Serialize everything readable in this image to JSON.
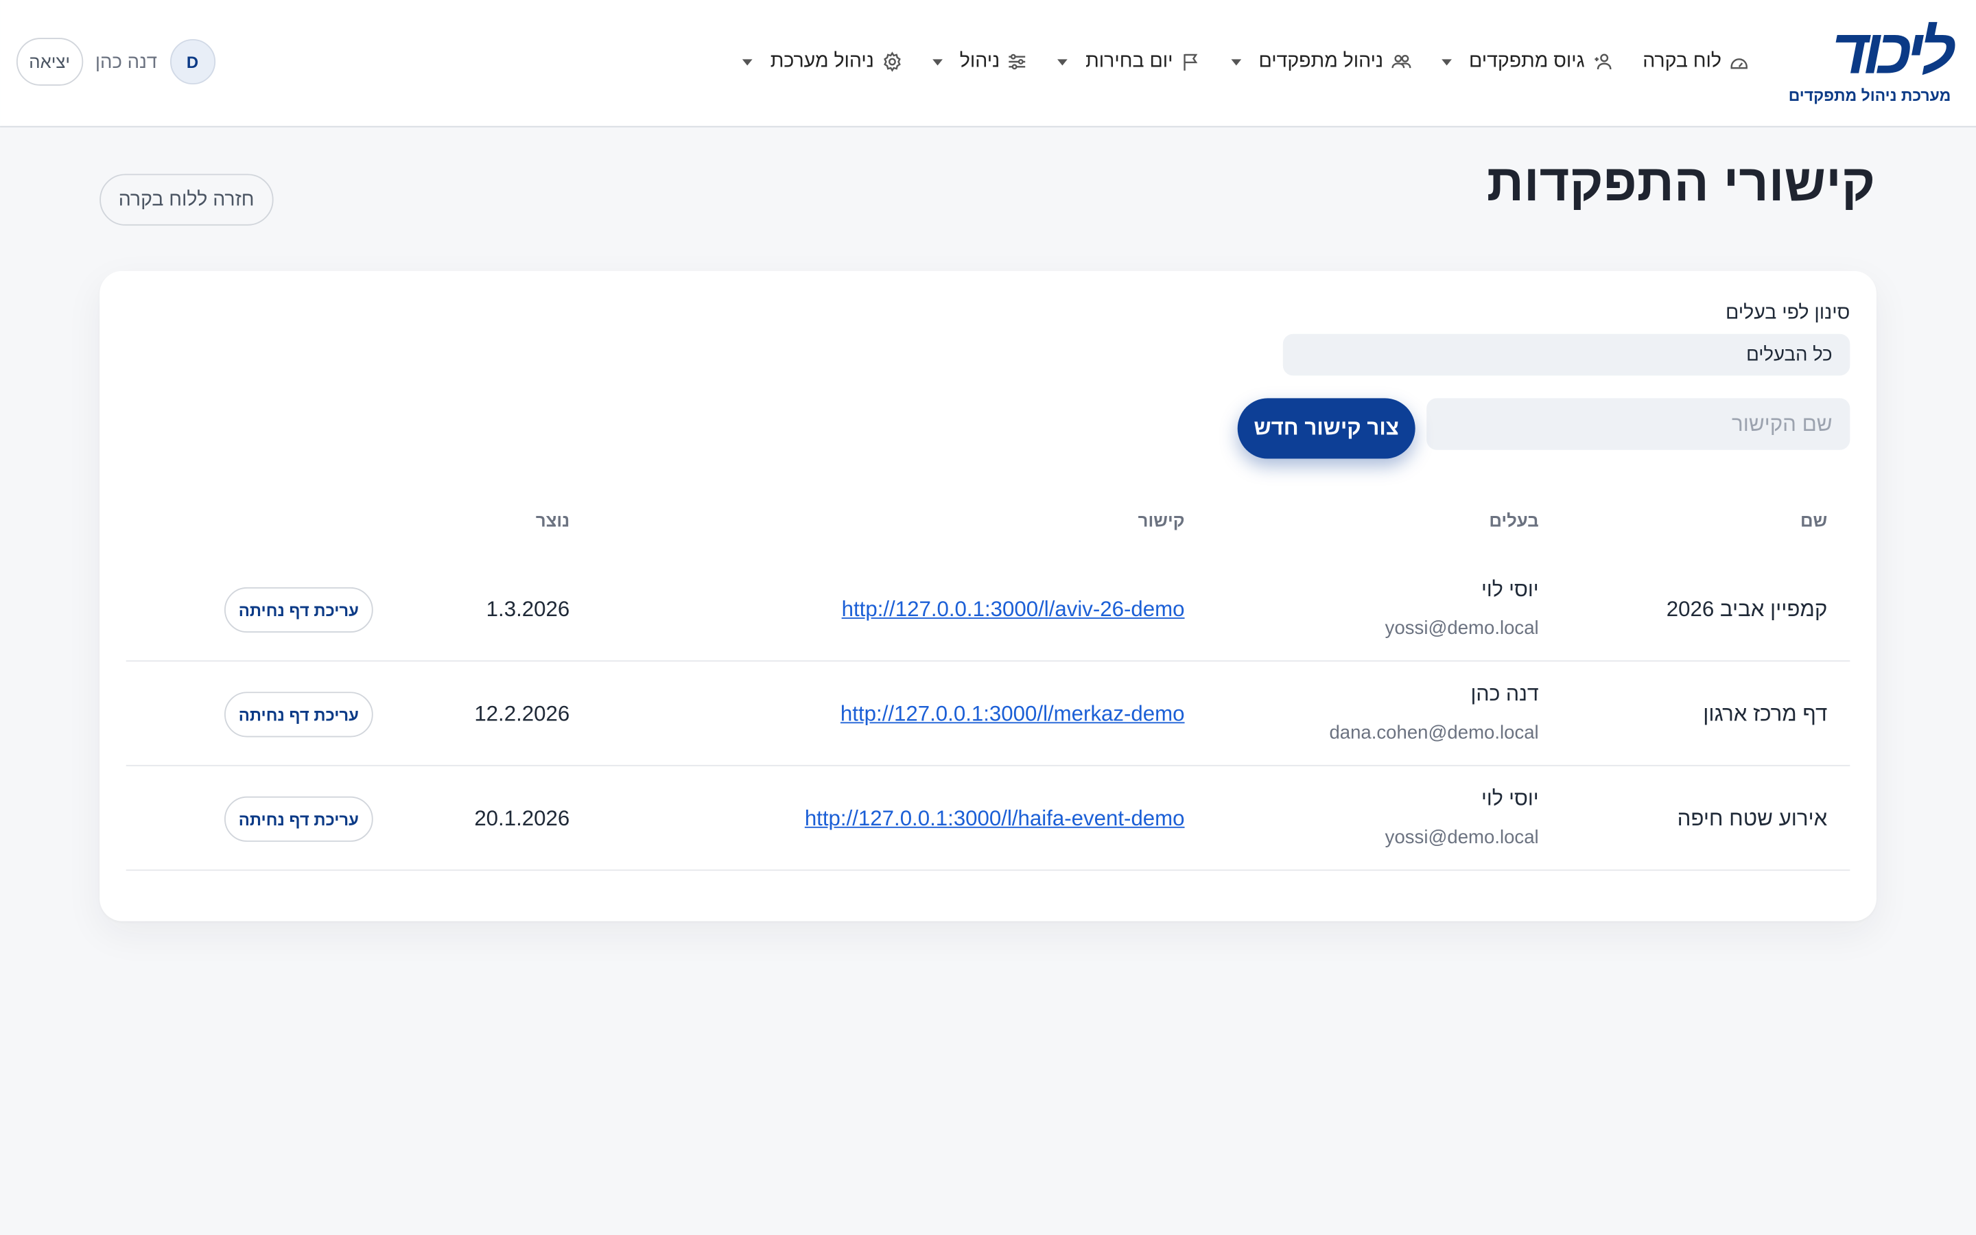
{
  "header": {
    "logo_word": "ליכוד",
    "logo_sub": "מערכת ניהול מתפקדים",
    "nav": [
      {
        "label": "לוח בקרה",
        "icon": "dashboard-icon",
        "has_caret": false
      },
      {
        "label": "גיוס מתפקדים",
        "icon": "user-plus-icon",
        "has_caret": true
      },
      {
        "label": "ניהול מתפקדים",
        "icon": "users-icon",
        "has_caret": true
      },
      {
        "label": "יום בחירות",
        "icon": "flag-icon",
        "has_caret": true
      },
      {
        "label": "ניהול",
        "icon": "sliders-icon",
        "has_caret": true
      },
      {
        "label": "ניהול מערכת",
        "icon": "gear-icon",
        "has_caret": true
      }
    ],
    "user": {
      "initial": "D",
      "name": "דנה כהן",
      "logout_label": "יציאה"
    }
  },
  "page": {
    "title": "קישורי התפקדות",
    "back_label": "חזרה ללוח בקרה"
  },
  "form": {
    "filter_label": "סינון לפי בעלים",
    "filter_value": "כל הבעלים",
    "name_placeholder": "שם הקישור",
    "create_label": "צור קישור חדש"
  },
  "table": {
    "headers": {
      "name": "שם",
      "owner": "בעלים",
      "link": "קישור",
      "created": "נוצר"
    },
    "rows": [
      {
        "name": "קמפיין אביב 2026",
        "owner_name": "יוסי לוי",
        "owner_email": "yossi@demo.local",
        "link": "http://127.0.0.1:3000/l/aviv-26-demo",
        "created": "1.3.2026",
        "action": "עריכת דף נחיתה"
      },
      {
        "name": "דף מרכז ארגון",
        "owner_name": "דנה כהן",
        "owner_email": "dana.cohen@demo.local",
        "link": "http://127.0.0.1:3000/l/merkaz-demo",
        "created": "12.2.2026",
        "action": "עריכת דף נחיתה"
      },
      {
        "name": "אירוע שטח חיפה",
        "owner_name": "יוסי לוי",
        "owner_email": "yossi@demo.local",
        "link": "http://127.0.0.1:3000/l/haifa-event-demo",
        "created": "20.1.2026",
        "action": "עריכת דף נחיתה"
      }
    ]
  },
  "colors": {
    "brand": "#0b3a86",
    "primary_button": "#0d3f96",
    "link": "#1b5fd6",
    "background": "#f6f7f9"
  }
}
